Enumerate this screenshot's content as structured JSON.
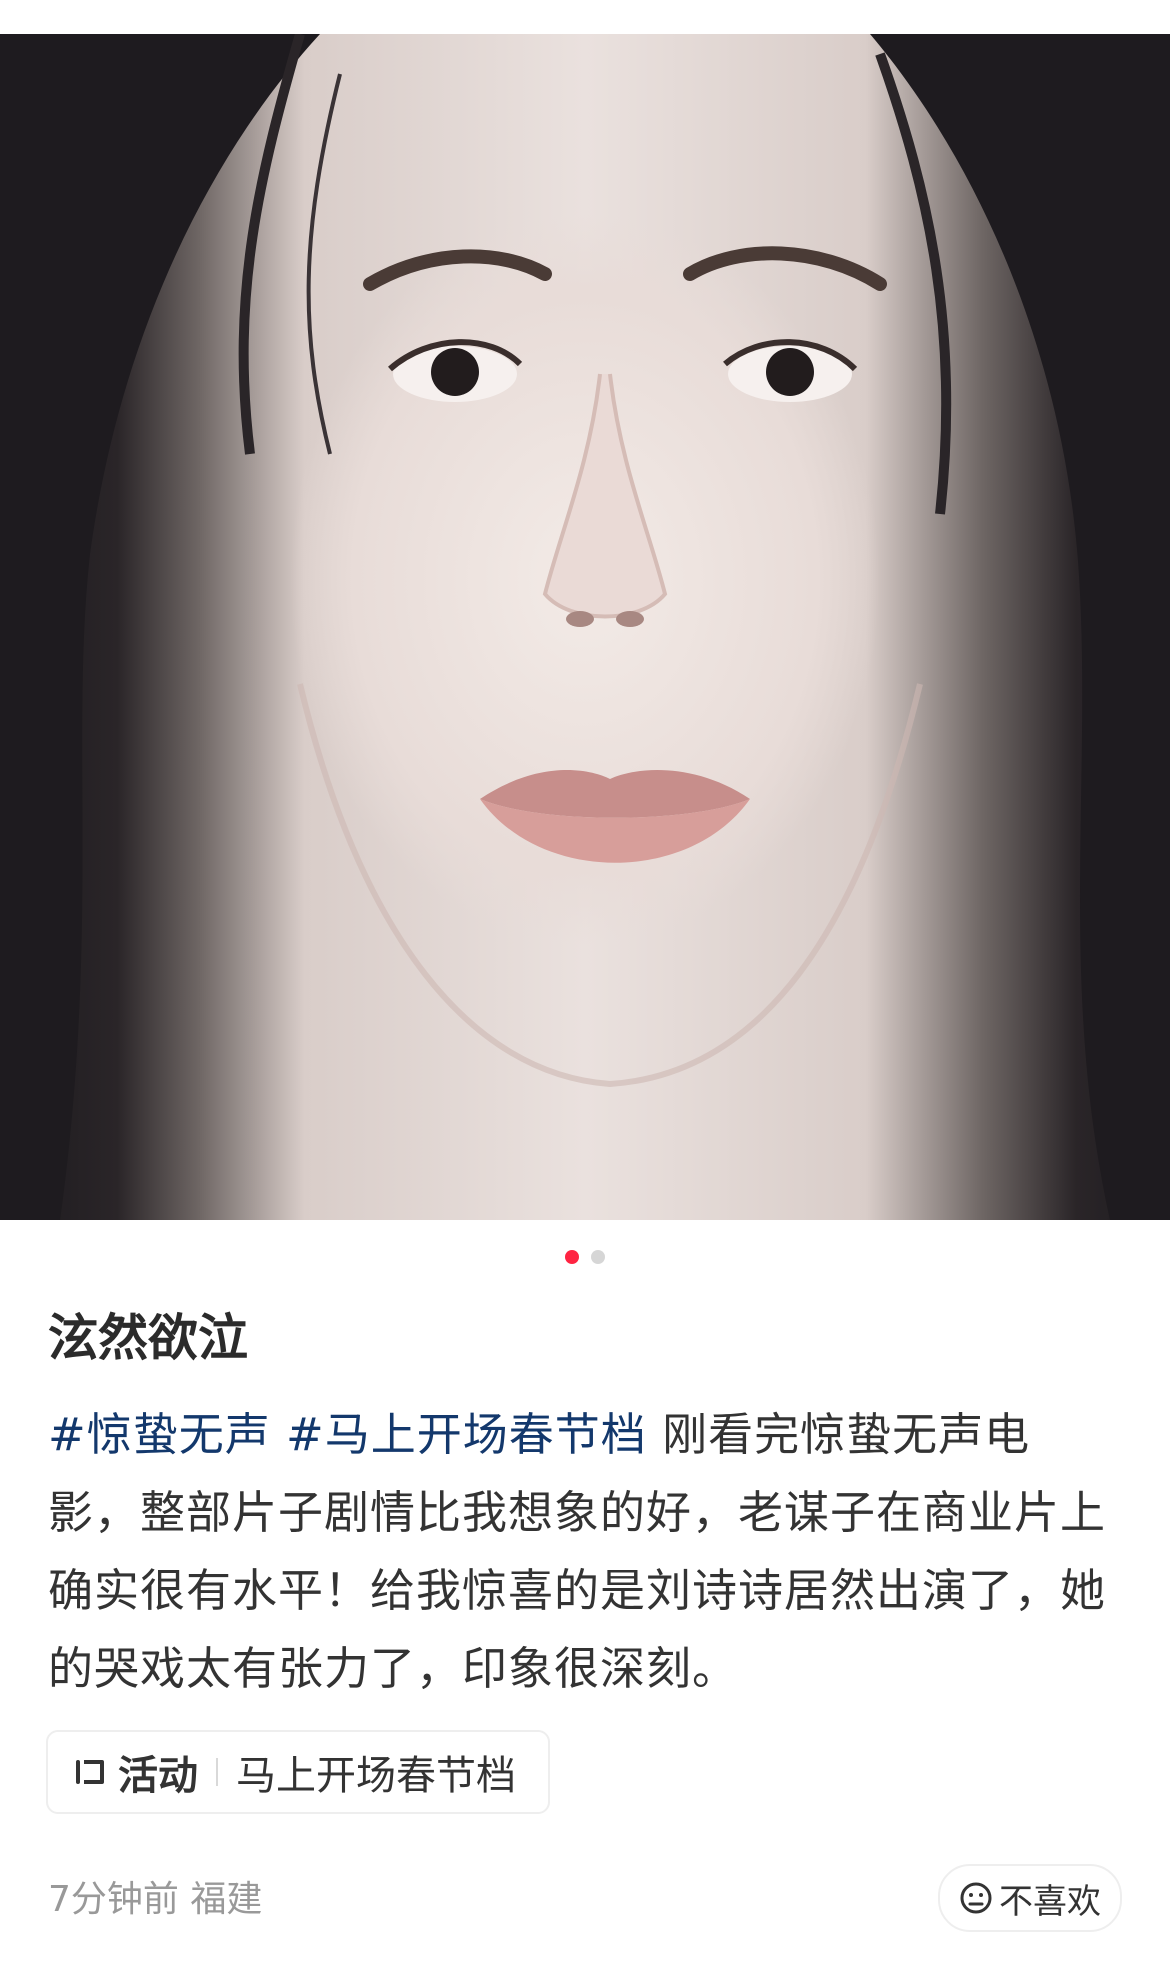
{
  "photo": {
    "alt_subject": "portrait",
    "carousel_total": 2,
    "carousel_active": 1
  },
  "post": {
    "title": "泫然欲泣",
    "tags": [
      "#惊蛰无声",
      "#马上开场春节档"
    ],
    "text": "刚看完惊蛰无声电影，整部片子剧情比我想象的好，老谋子在商业片上确实很有水平！给我惊喜的是刘诗诗居然出演了，她的哭戏太有张力了，印象很深刻。"
  },
  "activity": {
    "label": "活动",
    "value": "马上开场春节档",
    "icon": "activity-icon"
  },
  "meta": {
    "time": "7分钟前",
    "location": "福建"
  },
  "dislike": {
    "label": "不喜欢",
    "icon": "neutral-face-icon"
  },
  "colors": {
    "accent": "#ff2442",
    "tag": "#13386c",
    "muted": "#999999"
  }
}
